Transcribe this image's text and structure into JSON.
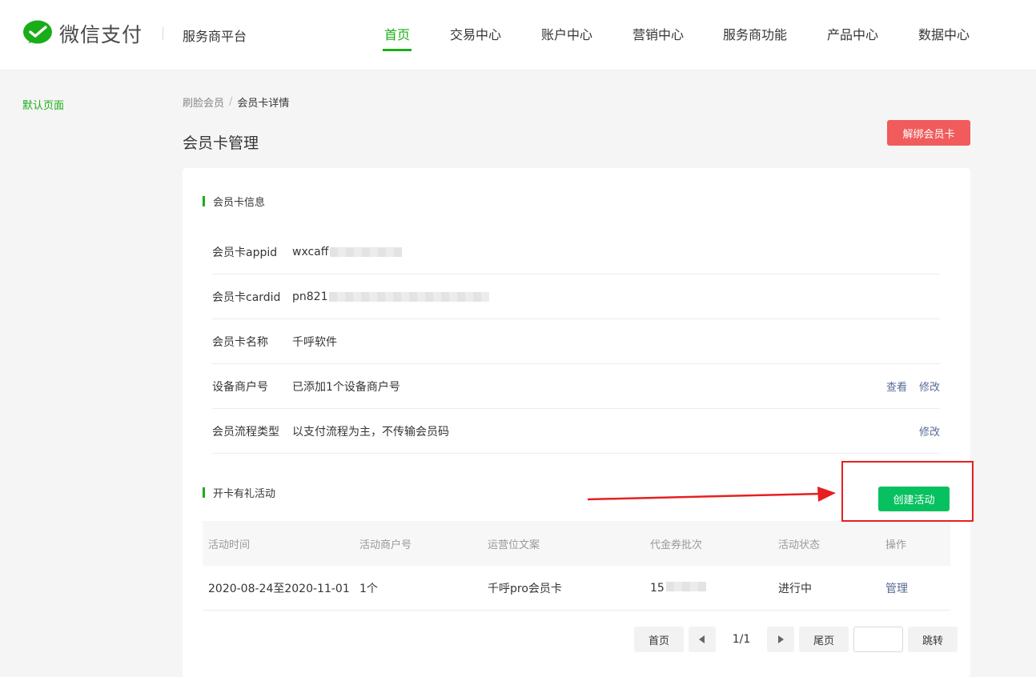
{
  "header": {
    "brand": "微信支付",
    "platform": "服务商平台",
    "nav": [
      "首页",
      "交易中心",
      "账户中心",
      "营销中心",
      "服务商功能",
      "产品中心",
      "数据中心"
    ]
  },
  "sidebar": {
    "items": [
      "默认页面"
    ]
  },
  "breadcrumb": {
    "parent": "刷脸会员",
    "current": "会员卡详情"
  },
  "page": {
    "title": "会员卡管理",
    "unbind_label": "解绑会员卡"
  },
  "card_info": {
    "section_title": "会员卡信息",
    "rows": [
      {
        "label": "会员卡appid",
        "value": "wxcaff"
      },
      {
        "label": "会员卡cardid",
        "value": "pn821"
      },
      {
        "label": "会员卡名称",
        "value": "千呼软件"
      },
      {
        "label": "设备商户号",
        "value": "已添加1个设备商户号",
        "actions": [
          "查看",
          "修改"
        ]
      },
      {
        "label": "会员流程类型",
        "value": "以支付流程为主，不传输会员码",
        "actions": [
          "修改"
        ]
      }
    ]
  },
  "activity": {
    "section_title": "开卡有礼活动",
    "create_label": "创建活动",
    "columns": [
      "活动时间",
      "活动商户号",
      "运营位文案",
      "代金券批次",
      "活动状态",
      "操作"
    ],
    "rows": [
      {
        "time": "2020-08-24至2020-11-01",
        "merchants": "1个",
        "copy": "千呼pro会员卡",
        "batch": "15",
        "status": "进行中",
        "action": "管理"
      }
    ]
  },
  "pager": {
    "first": "首页",
    "page": "1/1",
    "last": "尾页",
    "jump": "跳转"
  },
  "colors": {
    "brand_green": "#1aad19",
    "button_green": "#07c160",
    "danger": "#f15b5b",
    "link": "#576b95",
    "annotation": "#e62020"
  }
}
